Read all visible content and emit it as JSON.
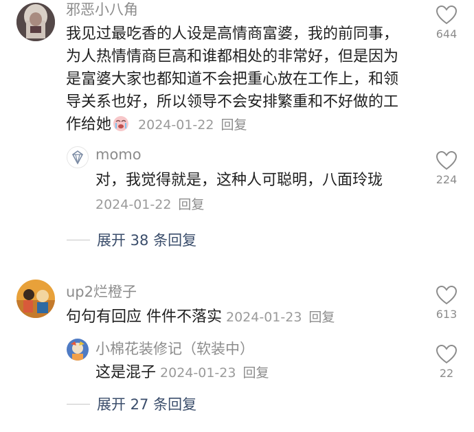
{
  "comments": [
    {
      "username": "邪恶小八角",
      "text_before_emoji": "我见过最吃香的人设是高情商富婆，我的前同事，为人热情情商巨高和谁都相处的非常好，但是因为是富婆大家也都知道不会把重心放在工作上，和领导关系也好，所以领导不会安排繁重和不好做的工作给她",
      "emoji": "crying-face-emoji",
      "date": "2024-01-22",
      "reply_label": "回复",
      "likes": "644",
      "replies": [
        {
          "username": "momo",
          "text": "对，我觉得就是，这种人可聪明，八面玲珑",
          "date": "2024-01-22",
          "reply_label": "回复",
          "likes": "224"
        }
      ],
      "expand_label": "展开 38 条回复"
    },
    {
      "username": "up2烂橙子",
      "text": "句句有回应 件件不落实",
      "date": "2024-01-23",
      "reply_label": "回复",
      "likes": "613",
      "replies": [
        {
          "username": "小棉花装修记（软装中）",
          "text": "这是混子",
          "date": "2024-01-23",
          "reply_label": "回复",
          "likes": "22"
        }
      ],
      "expand_label": "展开 27 条回复"
    }
  ],
  "icons": {
    "like": "heart-outline-icon"
  },
  "colors": {
    "text": "#1f1f1f",
    "meta": "#9a9a9a",
    "expand": "#3a4d6b"
  }
}
